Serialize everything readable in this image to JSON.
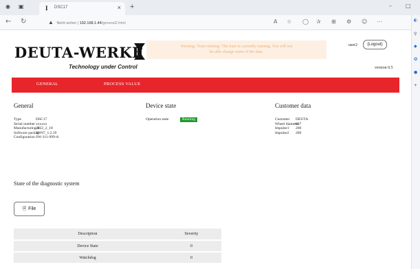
{
  "browser": {
    "tab_title": "DSC17",
    "tab_favicon": "deuta-favicon",
    "url_warning": "Nicht sicher",
    "url_host": "192.168.1.44",
    "url_path": "/general2.html"
  },
  "header": {
    "logo_text": "DEUTA-WERKE",
    "tagline": "Technology under Control",
    "warning_line1": "Warning: Train running: The train is currently running. You will not",
    "warning_line2": "be able change some of the data.",
    "user": "user2",
    "logout_label": "(Logout)",
    "version": "version 0.5"
  },
  "menu": {
    "items": [
      "GENERAL",
      "PROCESS VALUE"
    ]
  },
  "general": {
    "title": "General",
    "rows": [
      {
        "k": "Type",
        "v": "DSC17"
      },
      {
        "k": "Serial number",
        "v": "xxxxxx"
      },
      {
        "k": "Manufacturing d",
        "v": "2022_2_18"
      },
      {
        "k": "Software packag",
        "v": "SW67_1.2.19"
      },
      {
        "k": "Configuration",
        "v": "SW-111-999-A"
      }
    ]
  },
  "device_state": {
    "title": "Device state",
    "label": "Operation state",
    "value": "Running",
    "value_color": "#1e9a2c"
  },
  "customer": {
    "title": "Customer data",
    "rows": [
      {
        "k": "Customer",
        "v": "DEUTA"
      },
      {
        "k": "Wheel diameter",
        "v": "637"
      },
      {
        "k": "Impulse1",
        "v": "200"
      },
      {
        "k": "Impulse2",
        "v": "200"
      }
    ]
  },
  "diagnostic": {
    "title": "State of the diagnostic system",
    "file_label": "File",
    "columns": [
      "Description",
      "Severity"
    ],
    "rows": [
      {
        "description": "Device State",
        "severity": "0"
      },
      {
        "description": "Watchdog",
        "severity": "0"
      }
    ]
  },
  "colors": {
    "accent": "#e8252a",
    "warning_bg": "#fdf0e3",
    "warning_text": "#ecaf78"
  }
}
